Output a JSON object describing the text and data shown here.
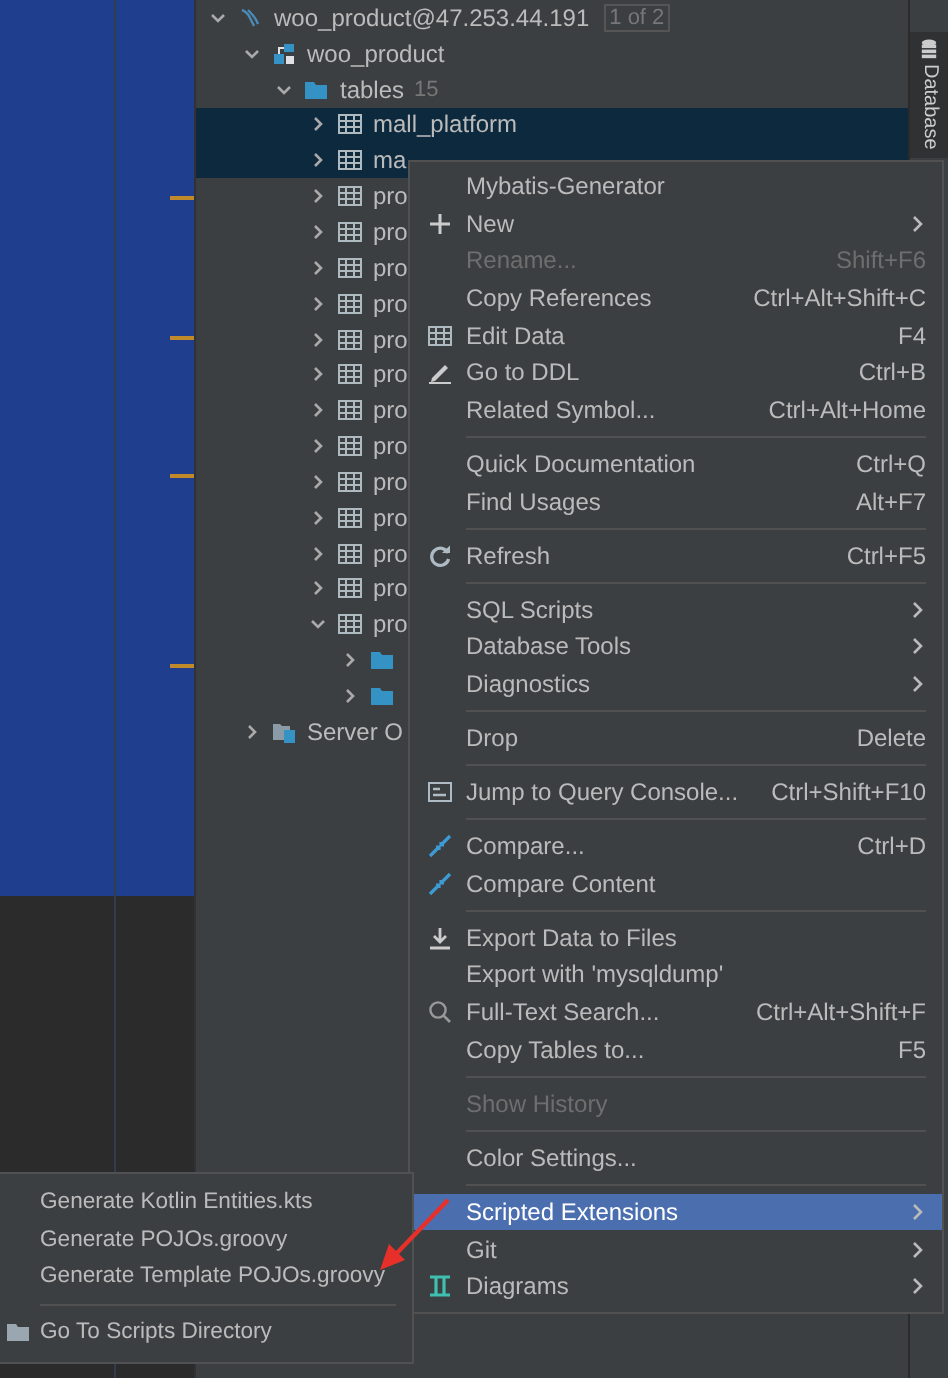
{
  "tool_window": {
    "label": "Database"
  },
  "tree": [
    {
      "kind": "datasource",
      "label": "woo_product@47.253.44.191",
      "badge": "1 of 2",
      "expanded": true,
      "selected": false,
      "children": [
        {
          "kind": "schema",
          "label": "woo_product",
          "expanded": true,
          "selected": false,
          "children": [
            {
              "kind": "folder",
              "label": "tables",
              "count": "15",
              "expanded": true,
              "selected": false,
              "children": [
                {
                  "kind": "table",
                  "label": "mall_platform",
                  "expanded": false,
                  "selected": true
                },
                {
                  "kind": "table",
                  "label": "ma",
                  "expanded": false,
                  "selected": true
                },
                {
                  "kind": "table",
                  "label": "pro",
                  "expanded": false,
                  "selected": false
                },
                {
                  "kind": "table",
                  "label": "pro",
                  "expanded": false,
                  "selected": false
                },
                {
                  "kind": "table",
                  "label": "pro",
                  "expanded": false,
                  "selected": false
                },
                {
                  "kind": "table",
                  "label": "pro",
                  "expanded": false,
                  "selected": false
                },
                {
                  "kind": "table",
                  "label": "pro",
                  "expanded": false,
                  "selected": false
                },
                {
                  "kind": "table",
                  "label": "pro",
                  "expanded": false,
                  "selected": false
                },
                {
                  "kind": "table",
                  "label": "pro",
                  "expanded": false,
                  "selected": false
                },
                {
                  "kind": "table",
                  "label": "pro",
                  "expanded": false,
                  "selected": false
                },
                {
                  "kind": "table",
                  "label": "pro",
                  "expanded": false,
                  "selected": false
                },
                {
                  "kind": "table",
                  "label": "pro",
                  "expanded": false,
                  "selected": false
                },
                {
                  "kind": "table",
                  "label": "pro",
                  "expanded": false,
                  "selected": false
                },
                {
                  "kind": "table",
                  "label": "pro",
                  "expanded": false,
                  "selected": false
                },
                {
                  "kind": "table",
                  "label": "pro",
                  "expanded": true,
                  "selected": false,
                  "children": [
                    {
                      "kind": "folder",
                      "expanded": false,
                      "selected": false
                    },
                    {
                      "kind": "folder",
                      "expanded": false,
                      "selected": false
                    }
                  ]
                }
              ]
            }
          ]
        },
        {
          "kind": "server-objects",
          "label": "Server O",
          "expanded": false,
          "selected": false
        }
      ]
    }
  ],
  "menu": {
    "items": [
      {
        "kind": "item",
        "label": "Mybatis-Generator",
        "disabled": false,
        "selected": false,
        "has_submenu": false
      },
      {
        "kind": "item",
        "label": "New",
        "disabled": false,
        "selected": false,
        "has_submenu": true
      },
      {
        "kind": "item",
        "label": "Rename...",
        "shortcut": "Shift+F6",
        "disabled": true,
        "selected": false,
        "has_submenu": false
      },
      {
        "kind": "item",
        "label": "Copy References",
        "shortcut": "Ctrl+Alt+Shift+C",
        "disabled": false,
        "selected": false,
        "has_submenu": false
      },
      {
        "kind": "item",
        "label": "Edit Data",
        "shortcut": "F4",
        "disabled": false,
        "selected": false,
        "has_submenu": false
      },
      {
        "kind": "item",
        "label": "Go to DDL",
        "shortcut": "Ctrl+B",
        "disabled": false,
        "selected": false,
        "has_submenu": false
      },
      {
        "kind": "item",
        "label": "Related Symbol...",
        "shortcut": "Ctrl+Alt+Home",
        "disabled": false,
        "selected": false,
        "has_submenu": false
      },
      {
        "kind": "separator"
      },
      {
        "kind": "item",
        "label": "Quick Documentation",
        "shortcut": "Ctrl+Q",
        "disabled": false,
        "selected": false,
        "has_submenu": false
      },
      {
        "kind": "item",
        "label": "Find Usages",
        "shortcut": "Alt+F7",
        "disabled": false,
        "selected": false,
        "has_submenu": false
      },
      {
        "kind": "separator"
      },
      {
        "kind": "item",
        "label": "Refresh",
        "shortcut": "Ctrl+F5",
        "disabled": false,
        "selected": false,
        "has_submenu": false
      },
      {
        "kind": "separator"
      },
      {
        "kind": "item",
        "label": "SQL Scripts",
        "disabled": false,
        "selected": false,
        "has_submenu": true
      },
      {
        "kind": "item",
        "label": "Database Tools",
        "disabled": false,
        "selected": false,
        "has_submenu": true
      },
      {
        "kind": "item",
        "label": "Diagnostics",
        "disabled": false,
        "selected": false,
        "has_submenu": true
      },
      {
        "kind": "separator"
      },
      {
        "kind": "item",
        "label": "Drop",
        "shortcut": "Delete",
        "disabled": false,
        "selected": false,
        "has_submenu": false
      },
      {
        "kind": "separator"
      },
      {
        "kind": "item",
        "label": "Jump to Query Console...",
        "shortcut": "Ctrl+Shift+F10",
        "disabled": false,
        "selected": false,
        "has_submenu": false
      },
      {
        "kind": "separator"
      },
      {
        "kind": "item",
        "label": "Compare...",
        "shortcut": "Ctrl+D",
        "disabled": false,
        "selected": false,
        "has_submenu": false
      },
      {
        "kind": "item",
        "label": "Compare Content",
        "disabled": false,
        "selected": false,
        "has_submenu": false
      },
      {
        "kind": "separator"
      },
      {
        "kind": "item",
        "label": "Export Data to Files",
        "disabled": false,
        "selected": false,
        "has_submenu": false
      },
      {
        "kind": "item",
        "label": "Export with 'mysqldump'",
        "disabled": false,
        "selected": false,
        "has_submenu": false
      },
      {
        "kind": "item",
        "label": "Full-Text Search...",
        "shortcut": "Ctrl+Alt+Shift+F",
        "disabled": false,
        "selected": false,
        "has_submenu": false
      },
      {
        "kind": "item",
        "label": "Copy Tables to...",
        "shortcut": "F5",
        "disabled": false,
        "selected": false,
        "has_submenu": false
      },
      {
        "kind": "separator"
      },
      {
        "kind": "item",
        "label": "Show History",
        "disabled": true,
        "selected": false,
        "has_submenu": false
      },
      {
        "kind": "separator"
      },
      {
        "kind": "item",
        "label": "Color Settings...",
        "disabled": false,
        "selected": false,
        "has_submenu": false
      },
      {
        "kind": "separator"
      },
      {
        "kind": "item",
        "label": "Scripted Extensions",
        "disabled": false,
        "selected": true,
        "has_submenu": true
      },
      {
        "kind": "item",
        "label": "Git",
        "disabled": false,
        "selected": false,
        "has_submenu": true
      },
      {
        "kind": "item",
        "label": "Diagrams",
        "disabled": false,
        "selected": false,
        "has_submenu": true
      }
    ]
  },
  "submenu": {
    "items": [
      {
        "kind": "item",
        "label": "Generate Kotlin Entities.kts",
        "selected": false
      },
      {
        "kind": "item",
        "label": "Generate POJOs.groovy",
        "selected": false
      },
      {
        "kind": "item",
        "label": "Generate Template POJOs.groovy",
        "selected": false
      },
      {
        "kind": "separator"
      },
      {
        "kind": "item",
        "label": "Go To Scripts Directory",
        "selected": false
      }
    ]
  }
}
